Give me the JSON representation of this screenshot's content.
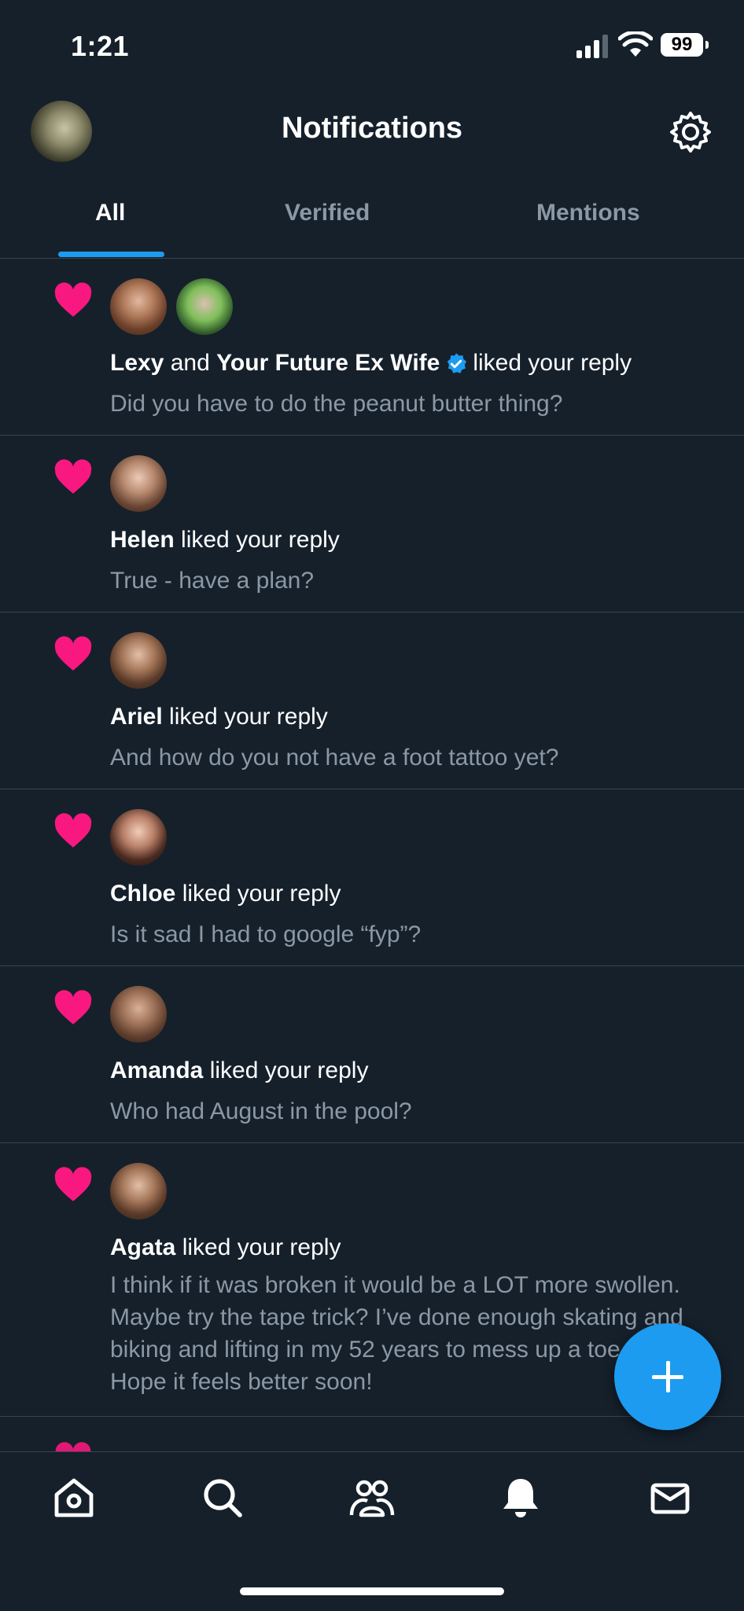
{
  "status_bar": {
    "time": "1:21",
    "battery": "99"
  },
  "header": {
    "title": "Notifications"
  },
  "tabs": [
    {
      "label": "All",
      "active": true
    },
    {
      "label": "Verified",
      "active": false
    },
    {
      "label": "Mentions",
      "active": false
    }
  ],
  "notifications": [
    {
      "user1": "Lexy",
      "conj": "and",
      "user2": "Your Future Ex Wife",
      "action": "liked your reply",
      "text": "Did you have to do the peanut butter thing?"
    },
    {
      "user1": "Helen",
      "action": "liked your reply",
      "text": "True - have a plan?"
    },
    {
      "user1": "Ariel",
      "action": "liked your reply",
      "text": "And how do you not have a foot tattoo yet?"
    },
    {
      "user1": "Chloe",
      "action": "liked your reply",
      "text": "Is it sad I had to google “fyp”?"
    },
    {
      "user1": "Amanda",
      "action": "liked your reply",
      "text": "Who had August in the pool?"
    },
    {
      "user1": "Agata",
      "action": "liked your reply",
      "text": "I think if it was broken it would be a LOT more swollen.  Maybe try the tape trick?  I’ve done enough skating and biking and lifting in my 52 years to mess up a toe or two!  Hope it feels better soon!"
    }
  ],
  "colors": {
    "background": "#15202b",
    "heart": "#f91880",
    "accent": "#1d9bf0",
    "secondary_text": "#8b98a5",
    "divider": "#38444d"
  },
  "icons": [
    "home-icon",
    "search-icon",
    "communities-icon",
    "notifications-bell-icon",
    "messages-icon",
    "settings-gear-icon",
    "compose-plus-icon",
    "heart-icon",
    "verified-badge-icon"
  ]
}
